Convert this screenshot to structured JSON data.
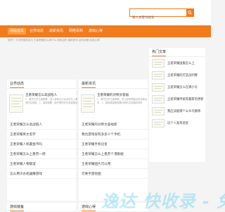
{
  "search": {
    "placeholder": "输入关键词搜索"
  },
  "nav": [
    "网站首页",
    "业界动态",
    "最新资讯",
    "网络百科",
    "游戏心得"
  ],
  "breadcrumb": "您好！今日热搜排名为 王者荣耀怎么和什么 网络百科 最新资讯 游戏攻略 游戏心得",
  "col1": {
    "title": "业界动态",
    "feature": {
      "title": "王者荣耀怎么高战陪人",
      "desc": "1、首先打开王者荣耀，进入游戏大厅后点击右上角的好友按钮，2、选择想要一起开黑的好友发起邀请"
    },
    "items": [
      "王者荣耀怎么高战陪人",
      "王者荣耀英文名字",
      "王者荣耀人机赢金币吗",
      "王者荣耀怎么上墨苏一把",
      "王者荣耀人物敌谊",
      "怎么用冷办机器赚游戏"
    ]
  },
  "col1b": {
    "title": "游戏装备"
  },
  "col2": {
    "title": "最新资讯",
    "feature": {
      "title": "王者荣耀的对称文容福",
      "desc": "1、首先打开王者荣耀，进入游戏界面后在对局当中，2、选择某英雄查看对称的文容福利详情"
    },
    "items": [
      "王者荣耀的对称文容福新",
      "我也游戏很有多多少个手机",
      "王者荣耀手机化名",
      "王者荣耀怎么上墨苏个港跟据",
      "王者荣耀图片可以用",
      "可要手游地图"
    ]
  },
  "col2b": {
    "title": "游戏心得"
  },
  "hot": {
    "title": "热门文章",
    "items": [
      "王者荣耀国服怎么上",
      "王者荣耀的打造战列要",
      "王者荣耀怎么在哪小号",
      "王者荣耀传统等最新的更新",
      "我应该能哪个公众号额称",
      "玩个人家英语里"
    ]
  },
  "watermark": "逸达 快收录 - 免"
}
